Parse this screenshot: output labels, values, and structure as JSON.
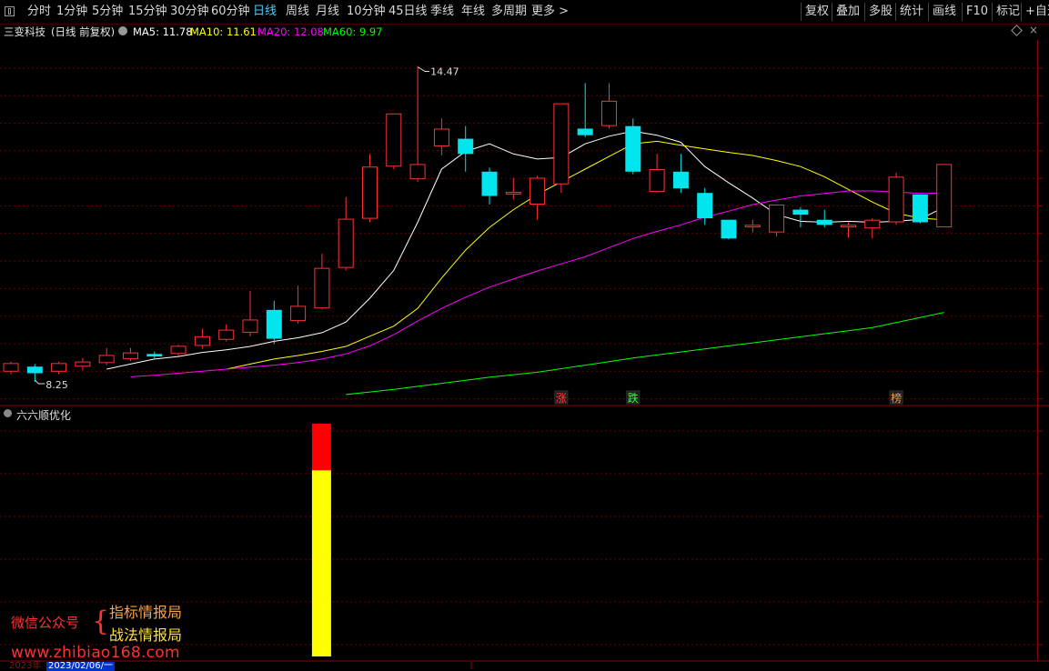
{
  "toolbar": {
    "periods": [
      {
        "label": "分时",
        "active": false
      },
      {
        "label": "1分钟",
        "active": false
      },
      {
        "label": "5分钟",
        "active": false
      },
      {
        "label": "15分钟",
        "active": false
      },
      {
        "label": "30分钟",
        "active": false
      },
      {
        "label": "60分钟",
        "active": false
      },
      {
        "label": "日线",
        "active": true
      },
      {
        "label": "周线",
        "active": false
      },
      {
        "label": "月线",
        "active": false
      },
      {
        "label": "10分钟",
        "active": false
      },
      {
        "label": "45日线",
        "active": false
      },
      {
        "label": "季线",
        "active": false
      },
      {
        "label": "年线",
        "active": false
      },
      {
        "label": "多周期",
        "active": false
      },
      {
        "label": "更多 >",
        "active": false
      }
    ],
    "right_buttons": [
      "复权",
      "叠加",
      "多股",
      "统计",
      "画线",
      "F10",
      "标记",
      "+自选"
    ]
  },
  "stock": {
    "name": "三变科技",
    "mode": "(日线 前复权)"
  },
  "ma": [
    {
      "label": "MA5:",
      "value": "11.78",
      "color": "#ffffff"
    },
    {
      "label": "MA10:",
      "value": "11.61",
      "color": "#ffff00"
    },
    {
      "label": "MA20:",
      "value": "12.08",
      "color": "#ff00ff"
    },
    {
      "label": "MA60:",
      "value": "9.97",
      "color": "#00ff00"
    }
  ],
  "indicator": {
    "name": "六六顺优化"
  },
  "chart_data": {
    "type": "candlestick",
    "price_range": [
      7.8,
      15.0
    ],
    "colors": {
      "up": "#ff3232",
      "down": "#00e5ee",
      "ma5": "#ffffff",
      "ma10": "#ffff00",
      "ma20": "#ff00ff",
      "ma60": "#00ff00"
    },
    "candles": [
      {
        "o": 8.45,
        "c": 8.62,
        "h": 8.65,
        "l": 8.4
      },
      {
        "o": 8.55,
        "c": 8.42,
        "h": 8.6,
        "l": 8.25
      },
      {
        "o": 8.45,
        "c": 8.62,
        "h": 8.65,
        "l": 8.4
      },
      {
        "o": 8.55,
        "c": 8.65,
        "h": 8.72,
        "l": 8.48
      },
      {
        "o": 8.62,
        "c": 8.78,
        "h": 8.92,
        "l": 8.58
      },
      {
        "o": 8.7,
        "c": 8.83,
        "h": 8.92,
        "l": 8.66
      },
      {
        "o": 8.8,
        "c": 8.75,
        "h": 8.85,
        "l": 8.7
      },
      {
        "o": 8.8,
        "c": 8.96,
        "h": 8.98,
        "l": 8.76
      },
      {
        "o": 8.96,
        "c": 9.15,
        "h": 9.3,
        "l": 8.9
      },
      {
        "o": 9.08,
        "c": 9.28,
        "h": 9.38,
        "l": 9.05
      },
      {
        "o": 9.22,
        "c": 9.48,
        "h": 10.05,
        "l": 9.15
      },
      {
        "o": 9.67,
        "c": 9.1,
        "h": 9.85,
        "l": 9.0
      },
      {
        "o": 9.45,
        "c": 9.75,
        "h": 10.15,
        "l": 9.4
      },
      {
        "o": 9.7,
        "c": 10.5,
        "h": 10.78,
        "l": 9.68
      },
      {
        "o": 10.5,
        "c": 11.47,
        "h": 11.9,
        "l": 10.45
      },
      {
        "o": 11.47,
        "c": 12.5,
        "h": 12.75,
        "l": 11.4
      },
      {
        "o": 12.5,
        "c": 13.55,
        "h": 13.55,
        "l": 12.45
      },
      {
        "o": 12.25,
        "c": 12.55,
        "h": 14.47,
        "l": 12.2
      },
      {
        "o": 12.9,
        "c": 13.25,
        "h": 13.45,
        "l": 12.72
      },
      {
        "o": 13.05,
        "c": 12.75,
        "h": 13.3,
        "l": 12.4
      },
      {
        "o": 12.4,
        "c": 11.92,
        "h": 12.48,
        "l": 11.75
      },
      {
        "o": 11.95,
        "c": 12.0,
        "h": 12.28,
        "l": 11.85
      },
      {
        "o": 11.75,
        "c": 12.28,
        "h": 12.32,
        "l": 11.45
      },
      {
        "o": 12.15,
        "c": 13.75,
        "h": 13.75,
        "l": 11.98
      },
      {
        "o": 13.25,
        "c": 13.12,
        "h": 14.15,
        "l": 13.08
      },
      {
        "o": 13.3,
        "c": 13.8,
        "h": 14.15,
        "l": 13.25
      },
      {
        "o": 13.3,
        "c": 12.4,
        "h": 13.45,
        "l": 12.35
      },
      {
        "o": 12.0,
        "c": 12.45,
        "h": 12.75,
        "l": 12.0
      },
      {
        "o": 12.4,
        "c": 12.07,
        "h": 12.75,
        "l": 11.98
      },
      {
        "o": 11.98,
        "c": 11.48,
        "h": 12.08,
        "l": 11.35
      },
      {
        "o": 11.45,
        "c": 11.08,
        "h": 11.45,
        "l": 11.06
      },
      {
        "o": 11.3,
        "c": 11.35,
        "h": 11.45,
        "l": 11.2
      },
      {
        "o": 11.2,
        "c": 11.75,
        "h": 11.75,
        "l": 11.12
      },
      {
        "o": 11.65,
        "c": 11.55,
        "h": 11.7,
        "l": 11.3
      },
      {
        "o": 11.45,
        "c": 11.35,
        "h": 11.65,
        "l": 11.3
      },
      {
        "o": 11.3,
        "c": 11.35,
        "h": 11.4,
        "l": 11.1
      },
      {
        "o": 11.28,
        "c": 11.45,
        "h": 11.48,
        "l": 11.08
      },
      {
        "o": 11.4,
        "c": 12.3,
        "h": 12.38,
        "l": 11.35
      },
      {
        "o": 11.95,
        "c": 11.4,
        "h": 11.95,
        "l": 11.38
      },
      {
        "o": 11.3,
        "c": 12.55,
        "h": 12.55,
        "l": 11.3
      }
    ],
    "ma5": [
      null,
      null,
      null,
      null,
      8.5,
      8.6,
      8.7,
      8.75,
      8.83,
      8.88,
      8.95,
      9.05,
      9.12,
      9.22,
      9.43,
      9.9,
      10.45,
      11.4,
      12.45,
      12.8,
      12.95,
      12.75,
      12.65,
      12.68,
      12.95,
      13.1,
      13.2,
      13.12,
      12.98,
      12.5,
      12.18,
      11.88,
      11.55,
      11.42,
      11.4,
      11.42,
      11.4,
      11.42,
      11.46,
      11.7
    ],
    "ma10": [
      null,
      null,
      null,
      null,
      null,
      null,
      null,
      null,
      null,
      8.5,
      8.6,
      8.7,
      8.77,
      8.85,
      8.95,
      9.15,
      9.35,
      9.7,
      10.3,
      10.85,
      11.3,
      11.65,
      11.95,
      12.2,
      12.45,
      12.7,
      12.95,
      13.0,
      12.92,
      12.85,
      12.78,
      12.72,
      12.62,
      12.5,
      12.3,
      12.05,
      11.8,
      11.58,
      11.48,
      11.45
    ],
    "ma20": [
      null,
      null,
      null,
      null,
      null,
      8.35,
      8.38,
      8.42,
      8.46,
      8.5,
      8.54,
      8.58,
      8.63,
      8.7,
      8.8,
      8.96,
      9.18,
      9.45,
      9.7,
      9.92,
      10.12,
      10.28,
      10.44,
      10.58,
      10.72,
      10.9,
      11.08,
      11.22,
      11.35,
      11.5,
      11.62,
      11.75,
      11.84,
      11.92,
      11.97,
      12.02,
      12.02,
      12.0,
      11.97,
      11.98
    ],
    "ma60": [
      null,
      null,
      null,
      null,
      null,
      null,
      null,
      null,
      null,
      null,
      null,
      null,
      null,
      null,
      8.0,
      8.05,
      8.1,
      8.16,
      8.22,
      8.28,
      8.34,
      8.39,
      8.44,
      8.51,
      8.58,
      8.65,
      8.72,
      8.78,
      8.84,
      8.9,
      8.96,
      9.02,
      9.08,
      9.14,
      9.2,
      9.26,
      9.32,
      9.42,
      9.52,
      9.62
    ],
    "high_label": {
      "index": 17,
      "text": "14.47"
    },
    "low_label": {
      "index": 1,
      "text": "8.25"
    },
    "markers": [
      {
        "index": 23,
        "text": "涨",
        "color": "#ff4040"
      },
      {
        "index": 26,
        "text": "跌",
        "color": "#40ff40"
      },
      {
        "index": 37,
        "text": "榜",
        "color": "#ffa040"
      }
    ],
    "indicator_bars": [
      {
        "index": 13,
        "value": 1.0,
        "top_frac": 0.2,
        "top_color": "#ff0000",
        "bottom_color": "#ffff00"
      }
    ]
  },
  "watermark": {
    "line1": "微信公众号",
    "line2": "指标情报局",
    "line3": "战法情报局",
    "url": "www.zhibiao168.com"
  },
  "dates": {
    "current": "2023/02/06/一",
    "faded": "2023年"
  }
}
